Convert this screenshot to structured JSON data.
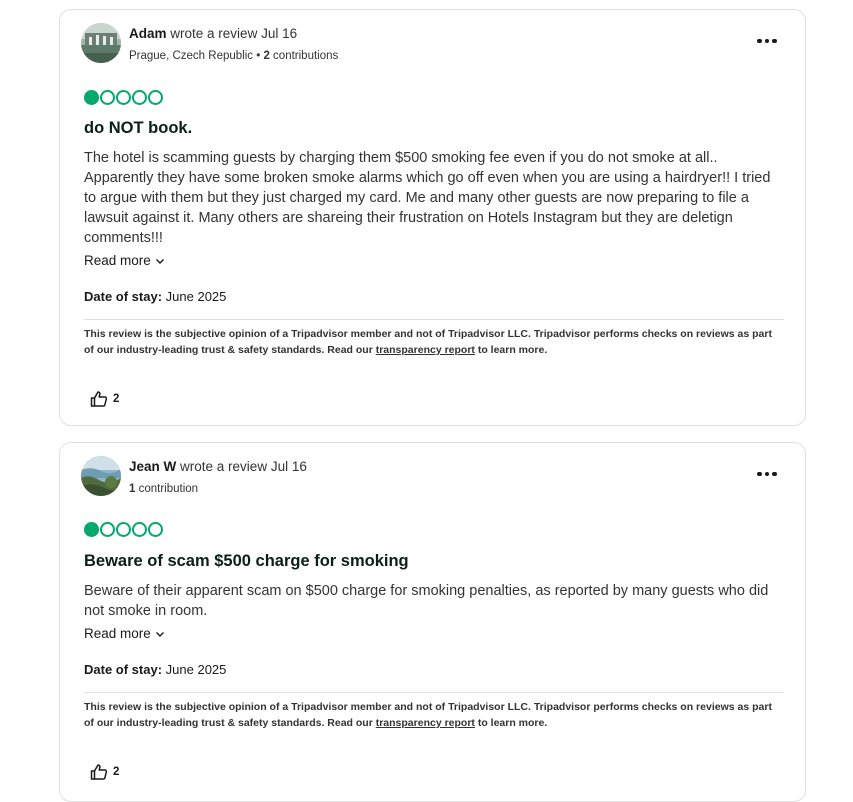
{
  "reviews": [
    {
      "reviewer_name": "Adam",
      "action_text": "wrote a review Jul 16",
      "location": "Prague, Czech Republic",
      "meta_sep": " • ",
      "contributions_count": "2",
      "contributions_label": "contributions",
      "rating": 1,
      "title": "do NOT book.",
      "body": "The hotel is scamming guests by charging them $500 smoking fee even if you do not smoke at all.. Apparently they have some broken smoke alarms which go off even when you are using a hairdryer!! I tried to argue with them but they just charged my card. Me and many other guests are now preparing to file a lawsuit against it. Many others are shareing their frustration on Hotels Instagram but they are deletign comments!!!",
      "read_more": "Read more",
      "date_of_stay_label": "Date of stay:",
      "date_of_stay": "June 2025",
      "disclaimer_pre": "This review is the subjective opinion of a Tripadvisor member and not of Tripadvisor LLC. Tripadvisor performs checks on reviews as part of our industry-leading trust & safety standards. Read our",
      "disclaimer_link": "transparency report",
      "disclaimer_post": "to learn more.",
      "helpful_count": "2"
    },
    {
      "reviewer_name": "Jean W",
      "action_text": "wrote a review Jul 16",
      "location": "",
      "meta_sep": "",
      "contributions_count": "1",
      "contributions_label": "contribution",
      "rating": 1,
      "title": "Beware of scam $500 charge for smoking",
      "body": "Beware of their apparent scam on $500 charge for smoking penalties, as reported by many guests who did not smoke in room.",
      "read_more": "Read more",
      "date_of_stay_label": "Date of stay:",
      "date_of_stay": "June 2025",
      "disclaimer_pre": "This review is the subjective opinion of a Tripadvisor member and not of Tripadvisor LLC. Tripadvisor performs checks on reviews as part of our industry-leading trust & safety standards. Read our",
      "disclaimer_link": "transparency report",
      "disclaimer_post": "to learn more.",
      "helpful_count": "2"
    }
  ],
  "icons": {
    "more": "more-options-icon",
    "thumbs_up": "thumbs-up-icon",
    "chevron": "chevron-down-icon"
  },
  "colors": {
    "rating_bubble": "#00aa6c",
    "border": "#e0e0e0"
  }
}
